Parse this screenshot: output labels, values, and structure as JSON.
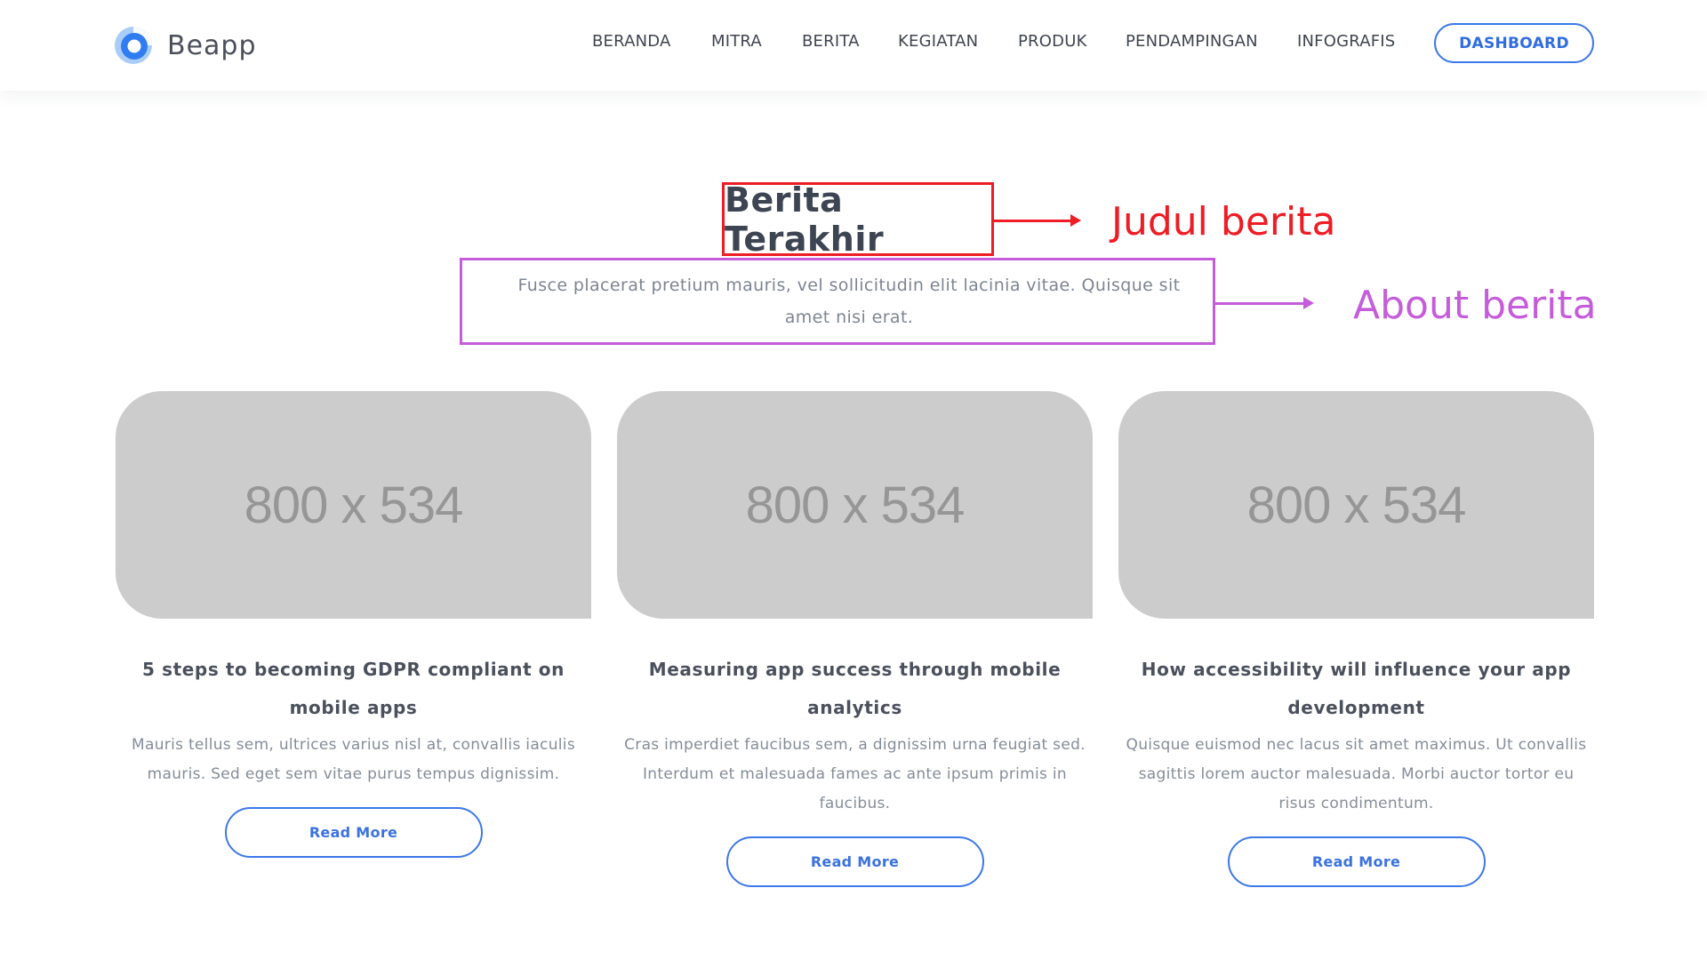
{
  "header": {
    "brand": "Beapp",
    "nav": [
      "BERANDA",
      "MITRA",
      "BERITA",
      "KEGIATAN",
      "PRODUK",
      "PENDAMPINGAN",
      "INFOGRAFIS"
    ],
    "dashboard_label": "DASHBOARD"
  },
  "section": {
    "title": "Berita Terakhir",
    "about": "Fusce placerat pretium mauris, vel sollicitudin elit lacinia vitae. Quisque sit amet nisi erat."
  },
  "annotations": {
    "title_note": "Judul berita",
    "about_note": "About berita"
  },
  "cards": [
    {
      "image_label": "800 x 534",
      "title": "5 steps to becoming GDPR compliant on mobile apps",
      "description": "Mauris tellus sem, ultrices varius nisl at, convallis iaculis mauris. Sed eget sem vitae purus tempus dignissim.",
      "button": "Read More"
    },
    {
      "image_label": "800 x 534",
      "title": "Measuring app success through mobile analytics",
      "description": "Cras imperdiet faucibus sem, a dignissim urna feugiat sed. Interdum et malesuada fames ac ante ipsum primis in faucibus.",
      "button": "Read More"
    },
    {
      "image_label": "800 x 534",
      "title": "How accessibility will influence your app development",
      "description": "Quisque euismod nec lacus sit amet maximus. Ut convallis sagittis lorem auctor malesuada. Morbi auctor tortor eu risus condimentum.",
      "button": "Read More"
    }
  ],
  "colors": {
    "accent": "#3c78e8",
    "annotation_red": "#ee1c24",
    "annotation_purple": "#c55ddb",
    "placeholder": "#cccccc"
  },
  "icons": {
    "logo": "beapp-logo-icon"
  }
}
